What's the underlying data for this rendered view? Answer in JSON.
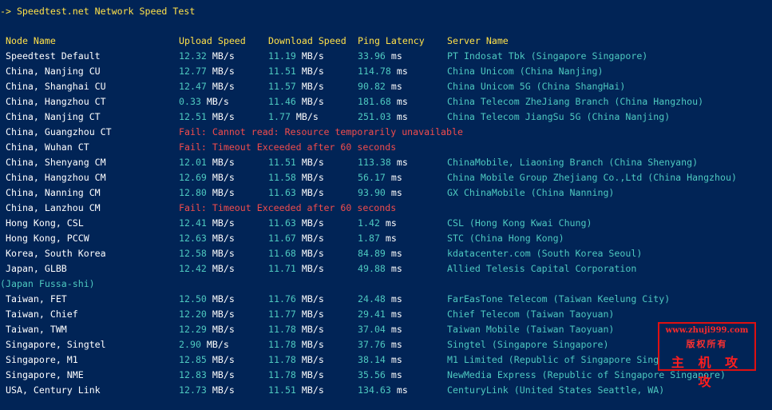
{
  "title": "-> Speedtest.net Network Speed Test",
  "headers": {
    "node": "Node Name",
    "upload": "Upload Speed",
    "download": "Download Speed",
    "ping": "Ping Latency",
    "server": "Server Name"
  },
  "units": {
    "speed": "MB/s",
    "ping": "ms"
  },
  "rows": [
    {
      "node": "Speedtest Default",
      "up": "12.32",
      "down": "11.19",
      "ping": "33.96",
      "server": "PT Indosat Tbk (Singapore Singapore)"
    },
    {
      "node": "China, Nanjing CU",
      "up": "12.77",
      "down": "11.51",
      "ping": "114.78",
      "server": "China Unicom (China Nanjing)"
    },
    {
      "node": "China, Shanghai CU",
      "up": "12.47",
      "down": "11.57",
      "ping": "90.82",
      "server": "China Unicom 5G (China ShangHai)"
    },
    {
      "node": "China, Hangzhou CT",
      "up": "0.33",
      "down": "11.46",
      "ping": "181.68",
      "server": "China Telecom ZheJiang Branch (China Hangzhou)"
    },
    {
      "node": "China, Nanjing CT",
      "up": "12.51",
      "down": "1.77",
      "ping": "251.03",
      "server": "China Telecom JiangSu 5G (China Nanjing)"
    },
    {
      "node": "China, Guangzhou CT",
      "error": "Fail: Cannot read: Resource temporarily unavailable"
    },
    {
      "node": "China, Wuhan CT",
      "error": "Fail: Timeout Exceeded after 60 seconds"
    },
    {
      "node": "China, Shenyang CM",
      "up": "12.01",
      "down": "11.51",
      "ping": "113.38",
      "server": "ChinaMobile, Liaoning Branch (China Shenyang)"
    },
    {
      "node": "China, Hangzhou CM",
      "up": "12.69",
      "down": "11.58",
      "ping": "56.17",
      "server": "China Mobile Group Zhejiang Co.,Ltd (China Hangzhou)"
    },
    {
      "node": "China, Nanning CM",
      "up": "12.80",
      "down": "11.63",
      "ping": "93.90",
      "server": "GX ChinaMobile (China Nanning)"
    },
    {
      "node": "China, Lanzhou CM",
      "error": "Fail: Timeout Exceeded after 60 seconds"
    },
    {
      "node": "Hong Kong, CSL",
      "up": "12.41",
      "down": "11.63",
      "ping": "1.42",
      "server": "CSL (Hong Kong Kwai Chung)"
    },
    {
      "node": "Hong Kong, PCCW",
      "up": "12.63",
      "down": "11.67",
      "ping": "1.87",
      "server": "STC (China Hong Kong)"
    },
    {
      "node": "Korea, South Korea",
      "up": "12.58",
      "down": "11.68",
      "ping": "84.89",
      "server": "kdatacenter.com (South Korea Seoul)"
    },
    {
      "node": "Japan, GLBB",
      "up": "12.42",
      "down": "11.71",
      "ping": "49.88",
      "server": "Allied Telesis Capital Corporation",
      "wrap": "(Japan Fussa-shi)"
    },
    {
      "node": "Taiwan, FET",
      "up": "12.50",
      "down": "11.76",
      "ping": "24.48",
      "server": "FarEasTone Telecom (Taiwan Keelung City)"
    },
    {
      "node": "Taiwan, Chief",
      "up": "12.20",
      "down": "11.77",
      "ping": "29.41",
      "server": "Chief Telecom (Taiwan Taoyuan)"
    },
    {
      "node": "Taiwan, TWM",
      "up": "12.29",
      "down": "11.78",
      "ping": "37.04",
      "server": "Taiwan Mobile (Taiwan Taoyuan)"
    },
    {
      "node": "Singapore, Singtel",
      "up": "2.90",
      "down": "11.78",
      "ping": "37.76",
      "server": "Singtel (Singapore Singapore)"
    },
    {
      "node": "Singapore, M1",
      "up": "12.85",
      "down": "11.78",
      "ping": "38.14",
      "server": "M1 Limited (Republic of Singapore Singapore)"
    },
    {
      "node": "Singapore, NME",
      "up": "12.83",
      "down": "11.78",
      "ping": "35.56",
      "server": "NewMedia Express (Republic of Singapore Singapore)"
    },
    {
      "node": "USA, Century Link",
      "up": "12.73",
      "down": "11.51",
      "ping": "134.63",
      "server": "CenturyLink (United States Seattle, WA)"
    }
  ],
  "watermark": {
    "url": "www.zhuji999.com",
    "sub": "版权所有",
    "main": "主 机 攻 攻"
  },
  "colors": {
    "background": "#012456",
    "number": "#4ec9c0",
    "header": "#ffe14a",
    "error": "#f14c4c",
    "text": "#ffffff"
  }
}
